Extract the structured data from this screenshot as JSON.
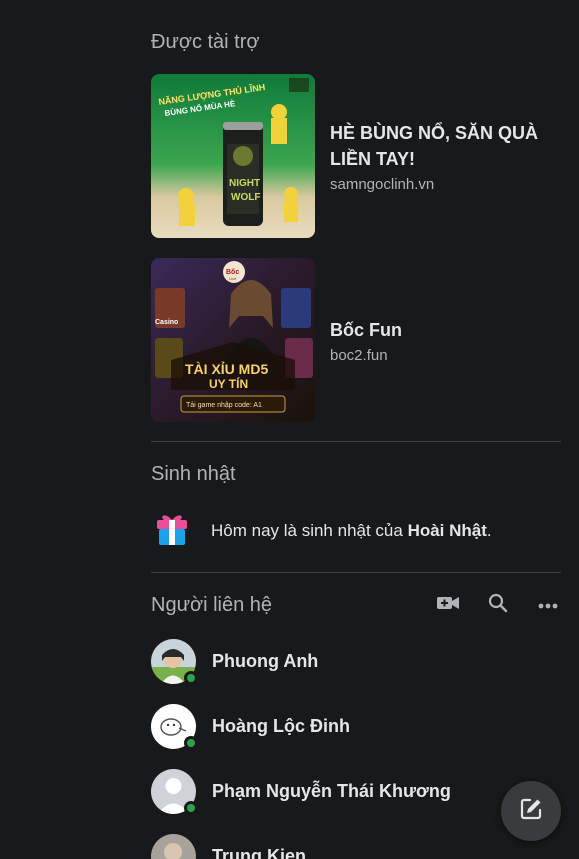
{
  "sponsored": {
    "title": "Được tài trợ",
    "ads": [
      {
        "title_line1": "HÈ BÙNG NỔ, SĂN QUÀ",
        "title_line2": "LIỀN TAY!",
        "domain": "samngoclinh.vn",
        "img_banner_line1": "NĂNG LƯỢNG THỦ LĨNH",
        "img_banner_line2": "BÙNG NỔ MÙA HÈ",
        "img_can_text_1": "NIGHT",
        "img_can_text_2": "WOLF"
      },
      {
        "title": "Bốc Fun",
        "domain": "boc2.fun",
        "img_logo": "Bốc",
        "img_logo_sub": "Live",
        "img_casino": "Casino",
        "img_headline_1": "TÀI XỈU MD5",
        "img_headline_2": "UY TÍN",
        "img_code": "Tải game nhập code: A1"
      }
    ]
  },
  "birthday": {
    "title": "Sinh nhật",
    "text_prefix": "Hôm nay là sinh nhật của ",
    "name": "Hoài Nhật",
    "text_suffix": ".",
    "icon": "gift-icon"
  },
  "contacts": {
    "title": "Người liên hệ",
    "actions": [
      "video-call-icon",
      "search-icon",
      "more-icon"
    ],
    "people": [
      {
        "name": "Phuong Anh",
        "online": true
      },
      {
        "name": "Hoàng Lộc Đinh",
        "online": true
      },
      {
        "name": "Phạm Nguyễn Thái Khương",
        "online": true
      },
      {
        "name": "Trung Kien",
        "online": false
      }
    ]
  },
  "fab": {
    "icon": "new-message-icon"
  },
  "colors": {
    "background": "#18191a",
    "text_primary": "#e4e6eb",
    "text_secondary": "#b0b3b8",
    "divider": "#3e4042",
    "online": "#31a24c",
    "fab_bg": "#3a3b3c"
  }
}
